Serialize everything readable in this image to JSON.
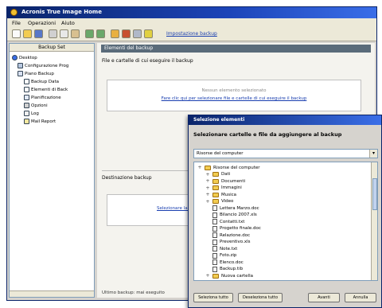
{
  "app": {
    "title": "Acronis True Image Home"
  },
  "menu": {
    "items": [
      "File",
      "Operazioni",
      "Aiuto"
    ]
  },
  "toolbar": {
    "buttons": [
      "new-icon",
      "open-icon",
      "save-icon",
      "cut-icon",
      "copy-icon",
      "paste-icon",
      "undo-icon",
      "redo-icon",
      "backup-icon",
      "restore-icon",
      "find-icon",
      "help-icon"
    ],
    "link_label": "Impostazione backup"
  },
  "tree": {
    "header": "Backup Set",
    "items": [
      {
        "label": "Desktop",
        "level": 0
      },
      {
        "label": "Configurazione Prog",
        "level": 1
      },
      {
        "label": "Piano Backup",
        "level": 1
      },
      {
        "label": "Backup Data",
        "level": 2
      },
      {
        "label": "Elementi di Back",
        "level": 2
      },
      {
        "label": "Pianificazione",
        "level": 2
      },
      {
        "label": "Opzioni",
        "level": 2
      },
      {
        "label": "Log",
        "level": 2
      },
      {
        "label": "Mail Report",
        "level": 2
      }
    ]
  },
  "content": {
    "section_title": "Elementi del backup",
    "group1_label": "File e cartelle di cui eseguire il backup",
    "box1_text": "Nessun elemento selezionato",
    "box1_link": "Fare clic qui per selezionare file e cartelle di cui eseguire il backup",
    "group2_label": "Destinazione backup",
    "box2_link": "Selezionare la destinazione",
    "status": "Ultimo backup: mai eseguito"
  },
  "dialog": {
    "title": "Selezione elementi",
    "heading": "Selezionare cartelle e file da aggiungere al backup",
    "combo_value": "Risorse del computer",
    "tree_items": [
      {
        "label": "Risorse del computer",
        "level": 0,
        "type": "folder"
      },
      {
        "label": "Dati",
        "level": 1,
        "type": "folder"
      },
      {
        "label": "Documenti",
        "level": 1,
        "type": "folder"
      },
      {
        "label": "Immagini",
        "level": 1,
        "type": "folder"
      },
      {
        "label": "Musica",
        "level": 1,
        "type": "folder"
      },
      {
        "label": "Video",
        "level": 1,
        "type": "folder"
      },
      {
        "label": "Lettera Marzo.doc",
        "level": 1,
        "type": "file"
      },
      {
        "label": "Bilancio 2007.xls",
        "level": 1,
        "type": "file"
      },
      {
        "label": "Contatti.txt",
        "level": 1,
        "type": "file"
      },
      {
        "label": "Progetto finale.doc",
        "level": 1,
        "type": "file"
      },
      {
        "label": "Relazione.doc",
        "level": 1,
        "type": "file"
      },
      {
        "label": "Preventivo.xls",
        "level": 1,
        "type": "file"
      },
      {
        "label": "Note.txt",
        "level": 1,
        "type": "file"
      },
      {
        "label": "Foto.zip",
        "level": 1,
        "type": "file"
      },
      {
        "label": "Elenco.doc",
        "level": 1,
        "type": "file"
      },
      {
        "label": "Backup.tib",
        "level": 1,
        "type": "file"
      },
      {
        "label": "Nuova cartella",
        "level": 1,
        "type": "folder"
      }
    ],
    "buttons": {
      "select_all": "Seleziona tutto",
      "clear_all": "Deseleziona tutto",
      "ok": "Avanti",
      "cancel": "Annulla"
    }
  },
  "colors": {
    "titlebar": "#0a246a",
    "link": "#1a3fb0",
    "section_header": "#5a6b7a"
  }
}
